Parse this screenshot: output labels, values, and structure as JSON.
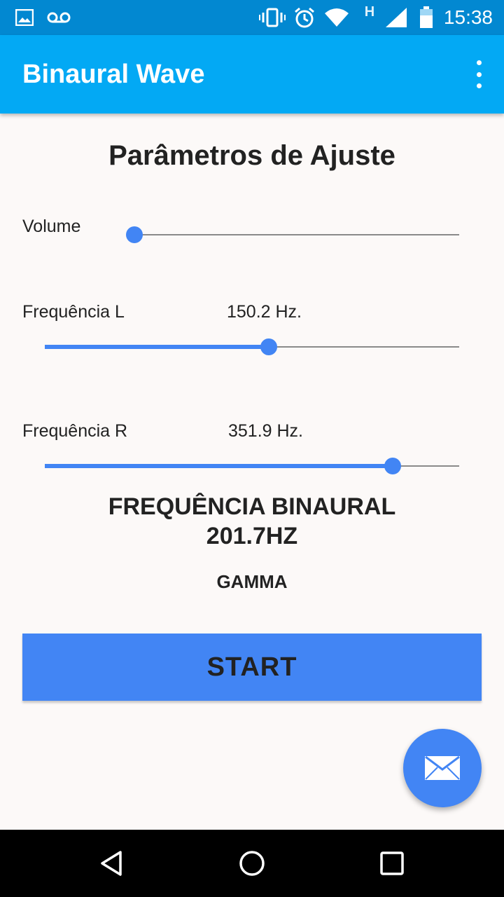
{
  "status_bar": {
    "time": "15:38",
    "icons": [
      "image-icon",
      "voicemail-icon",
      "vibrate-icon",
      "alarm-icon",
      "wifi-icon",
      "h-network-icon",
      "signal-icon",
      "battery-icon"
    ],
    "network_type": "H"
  },
  "app_bar": {
    "title": "Binaural Wave",
    "menu_icon": "more-vert-icon"
  },
  "main": {
    "heading": "Parâmetros de Ajuste",
    "volume": {
      "label": "Volume",
      "level": 0.0
    },
    "freq_left": {
      "label": "Frequência L",
      "value": "150.2 Hz.",
      "level": 0.54
    },
    "freq_right": {
      "label": "Frequência R",
      "value": "351.9 Hz.",
      "level": 0.84
    },
    "binaural_title": "FREQUÊNCIA BINAURAL",
    "binaural_value": "201.7HZ",
    "band": "GAMMA",
    "start_label": "START"
  },
  "fab": {
    "icon": "mail-icon"
  },
  "nav_bar": {
    "icons": [
      "back-icon",
      "home-icon",
      "recents-icon"
    ]
  },
  "colors": {
    "status_bar": "#0288d1",
    "app_bar": "#03a9f4",
    "accent": "#4285f4",
    "background": "#fcf9f8",
    "nav_bar": "#000000"
  }
}
